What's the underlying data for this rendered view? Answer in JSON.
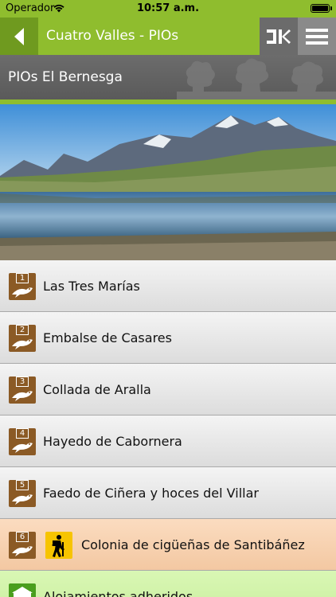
{
  "status": {
    "carrier": "Operador",
    "time": "10:57 a.m."
  },
  "nav": {
    "title": "Cuatro Valles - PIOs"
  },
  "section": {
    "title": "PIOs El Bernesga"
  },
  "items": [
    {
      "number": "1",
      "label": "Las Tres Marías"
    },
    {
      "number": "2",
      "label": "Embalse de Casares"
    },
    {
      "number": "3",
      "label": "Collada de Aralla"
    },
    {
      "number": "4",
      "label": "Hayedo de Cabornera"
    },
    {
      "number": "5",
      "label": "Faedo de Ciñera y hoces del Villar"
    },
    {
      "number": "6",
      "label": "Colonia de cigüeñas de Santibáñez"
    },
    {
      "label": "Alojamientos adheridos"
    }
  ],
  "colors": {
    "accent": "#8fbd2e",
    "poi_icon": "#8b5a25",
    "highlight_row": "#f6d0ad",
    "hiker_icon": "#f7c400"
  }
}
